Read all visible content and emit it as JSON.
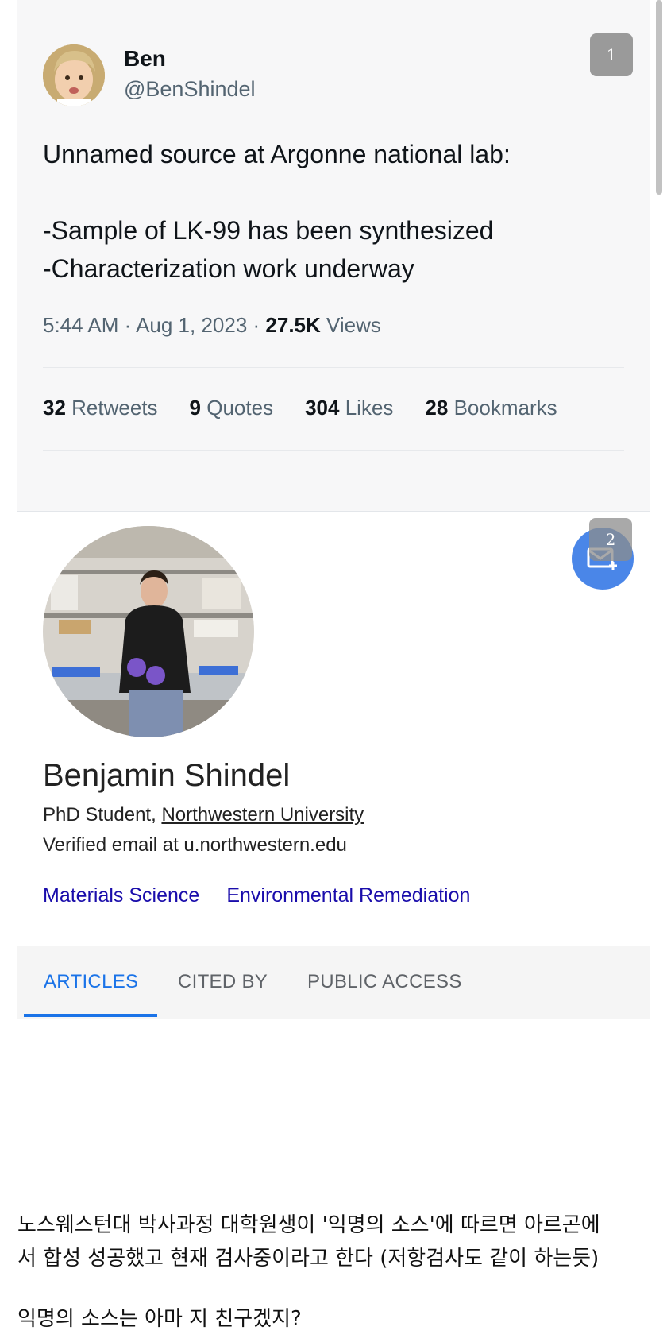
{
  "tweet": {
    "author_name": "Ben",
    "author_handle": "@BenShindel",
    "more_badge": "1",
    "text": "Unnamed source at Argonne national lab:\n\n-Sample of LK-99 has been synthesized\n-Characterization work underway",
    "time": "5:44 AM · Aug 1, 2023 · ",
    "views_count": "27.5K",
    "views_label": " Views",
    "stats": [
      {
        "count": "32",
        "label": "Retweets"
      },
      {
        "count": "9",
        "label": "Quotes"
      },
      {
        "count": "304",
        "label": "Likes"
      },
      {
        "count": "28",
        "label": "Bookmarks"
      }
    ]
  },
  "profile": {
    "fab_badge": "2",
    "name": "Benjamin Shindel",
    "role": "PhD Student, ",
    "university": "Northwestern University",
    "email": "Verified email at u.northwestern.edu",
    "interests": [
      "Materials Science",
      "Environmental Remediation"
    ],
    "tabs": [
      "ARTICLES",
      "CITED BY",
      "PUBLIC ACCESS"
    ],
    "active_tab": "ARTICLES"
  },
  "comment": {
    "line1": "노스웨스턴대 박사과정 대학원생이 '익명의 소스'에 따르면 아르곤에",
    "line2": "서 합성 성공했고 현재 검사중이라고 한다 (저항검사도 같이 하는듯)",
    "line3": "익명의 소스는 아마 지 친구겠지?"
  },
  "colors": {
    "link": "#1a0dab",
    "tab_active": "#1a73e8",
    "fab": "#4a86e8",
    "muted": "#536471"
  }
}
